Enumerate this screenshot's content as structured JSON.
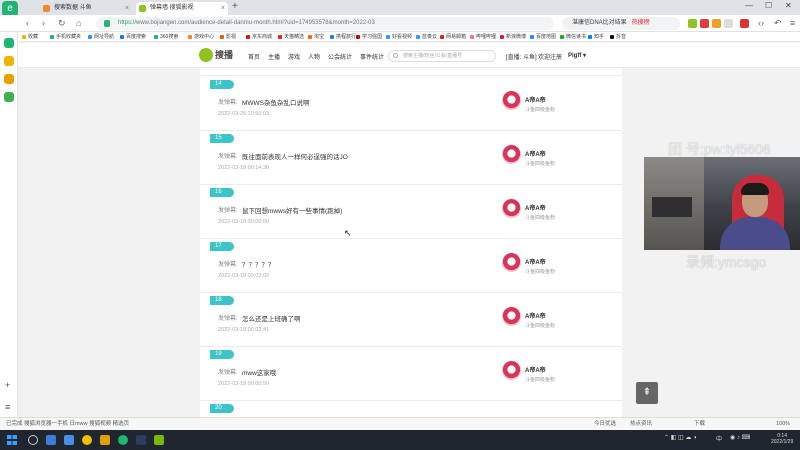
{
  "browser": {
    "tabs": [
      {
        "label": "搜索数据 斗鱼"
      },
      {
        "label": "弹幕墙 搜狐影视"
      }
    ],
    "new_tab": "+",
    "address": {
      "scheme": "https://",
      "rest": "www.bojiangen.com/audience-detail-danmu-month.html?uid=174953578&month=2022-03"
    },
    "search_box": {
      "text": "湛康信DNA比对结果",
      "hot": "热搜榜"
    },
    "bookmarks": [
      "收藏",
      "手机收藏夹",
      "网址导航",
      "百度搜索",
      "360搜索",
      "游戏中心",
      "影视",
      "京东商城",
      "天猫精选",
      "淘宝",
      "携程旅行",
      "学习强国",
      "好看视频",
      "蓝奏云",
      "网易邮箱",
      "哔哩哔哩",
      "新浪微博",
      "百度地图",
      "微信读书",
      "知乎",
      "抖音"
    ]
  },
  "site": {
    "logo_text": "搜播",
    "nav": [
      "首页",
      "主播",
      "游戏",
      "人物",
      "公会统计",
      "事件统计"
    ],
    "search_placeholder": "搜索主播/粉丝/公会/直播号",
    "right_links": [
      "[直播: 斗鱼]",
      "欢迎注册",
      "Pigff ▾"
    ]
  },
  "entries": [
    {
      "num": "14",
      "label": "发弹幕:",
      "text": "MWWS杂鱼杂乱口说啊",
      "date": "2022-03-25 10:50:03",
      "name": "A帝A帝",
      "sub": "斗鱼四级鱼粉"
    },
    {
      "num": "15",
      "label": "发弹幕:",
      "text": "既往面前表现人一样何必逞强的话JO",
      "date": "2022-03-18 00:14:30",
      "name": "A帝A帝",
      "sub": "斗鱼四级鱼粉"
    },
    {
      "num": "16",
      "label": "发弹幕:",
      "text": "鼠下回想mwws好有一些事情(跑掉)",
      "date": "2022-03-18 00:00:00",
      "name": "A帝A帝",
      "sub": "斗鱼四级鱼粉"
    },
    {
      "num": "17",
      "label": "发弹幕:",
      "text": "？？？？？",
      "date": "2022-03-18 00:02:02",
      "name": "A帝A帝",
      "sub": "斗鱼四级鱼粉"
    },
    {
      "num": "18",
      "label": "发弹幕:",
      "text": "怎么还是上班确了啊",
      "date": "2022-03-18 00:02:41",
      "name": "A帝A帝",
      "sub": "斗鱼四级鱼粉"
    },
    {
      "num": "19",
      "label": "发弹幕:",
      "text": "mww这家哦",
      "date": "2022-03-18 00:00:50",
      "name": "A帝A帝",
      "sub": "斗鱼四级鱼粉"
    }
  ],
  "last_num": "20",
  "to_top": "⇞",
  "watermark": {
    "top": "团  号:pw:tyl5606",
    "bottom": "录频:ymcsgo"
  },
  "status": {
    "left": "已完成 搜狐浏览器一手机 日mww 搜狐视频 精选页",
    "right_items": [
      "今日优选",
      "热点资讯",
      "下载",
      "100%"
    ]
  },
  "taskbar": {
    "tray": "中",
    "time": "0:14",
    "date": "2022/1/29"
  },
  "colors": {
    "accent": "#3cc4c9",
    "brand": "#21b573",
    "webcam_chair": "#c72c3d"
  }
}
